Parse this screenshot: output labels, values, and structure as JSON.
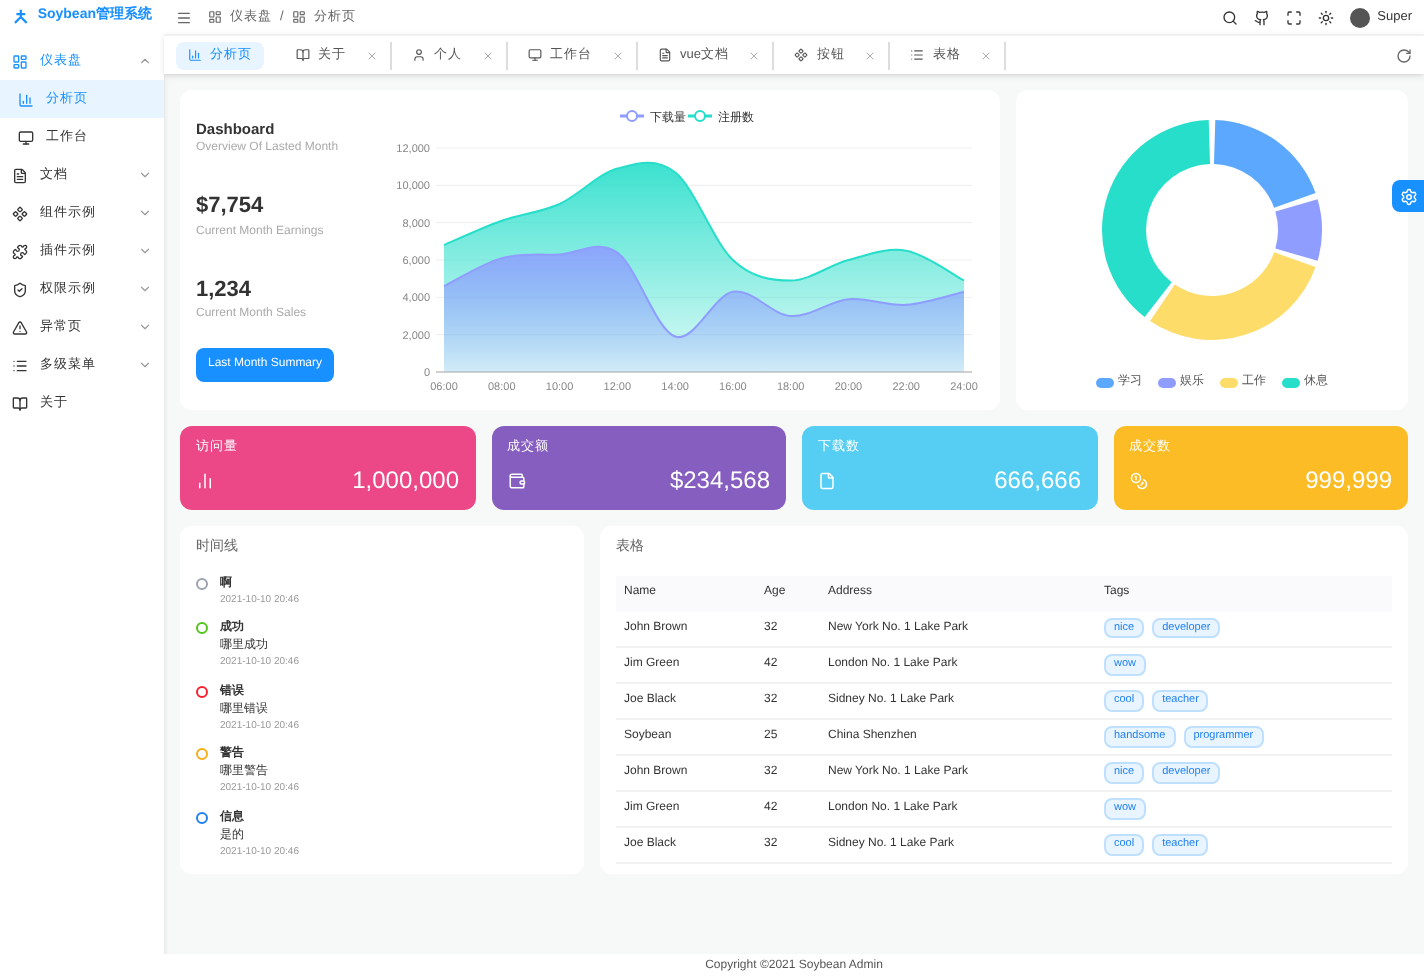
{
  "sidebar": {
    "logo": "Soybean管理系统",
    "items": [
      {
        "label": "仪表盘",
        "expanded": true,
        "children": [
          {
            "label": "分析页",
            "selected": true
          },
          {
            "label": "工作台",
            "selected": false
          }
        ]
      },
      {
        "label": "文档",
        "expanded": false
      },
      {
        "label": "组件示例",
        "expanded": false
      },
      {
        "label": "插件示例",
        "expanded": false
      },
      {
        "label": "权限示例",
        "expanded": false
      },
      {
        "label": "异常页",
        "expanded": false
      },
      {
        "label": "多级菜单",
        "expanded": false
      },
      {
        "label": "关于"
      }
    ]
  },
  "header": {
    "breadcrumb": [
      "仪表盘",
      "分析页"
    ],
    "breadcrumb_separator": "/",
    "user": "Super"
  },
  "tabs": [
    {
      "label": "分析页",
      "selected": true,
      "closable": false
    },
    {
      "label": "关于",
      "selected": false,
      "closable": true
    },
    {
      "label": "个人",
      "selected": false,
      "closable": true
    },
    {
      "label": "工作台",
      "selected": false,
      "closable": true
    },
    {
      "label": "vue文档",
      "selected": false,
      "closable": true
    },
    {
      "label": "按钮",
      "selected": false,
      "closable": true
    },
    {
      "label": "表格",
      "selected": false,
      "closable": true
    }
  ],
  "dashboard": {
    "title": "Dashboard",
    "subtitle": "Overview Of Lasted Month",
    "earnings": "$7,754",
    "earnings_label": "Current Month Earnings",
    "sales": "1,234",
    "sales_label": "Current Month Sales",
    "button": "Last Month Summary",
    "chart_data": {
      "type": "area",
      "categories": [
        "06:00",
        "08:00",
        "10:00",
        "12:00",
        "14:00",
        "16:00",
        "18:00",
        "20:00",
        "22:00",
        "24:00"
      ],
      "series": [
        {
          "name": "下载量",
          "color": "#8e9dff",
          "values": [
            4600,
            6100,
            6300,
            6400,
            1900,
            4300,
            3000,
            3900,
            3600,
            4300
          ]
        },
        {
          "name": "注册数",
          "color": "#26deca",
          "values": [
            6800,
            8100,
            9000,
            10900,
            10700,
            6000,
            4900,
            6000,
            6500,
            4900
          ]
        }
      ],
      "ylim": [
        0,
        12000
      ],
      "grid": true,
      "legend": true,
      "yticks": [
        {
          "value": 0,
          "label": "0"
        },
        {
          "value": 2000,
          "label": "2,000"
        },
        {
          "value": 4000,
          "label": "4,000"
        },
        {
          "value": 6000,
          "label": "6,000"
        },
        {
          "value": 8000,
          "label": "8,000"
        },
        {
          "value": 10000,
          "label": "10,000"
        },
        {
          "value": 12000,
          "label": "12,000"
        }
      ]
    }
  },
  "donut_legend": [
    {
      "label": "学习",
      "color": "#5da8ff"
    },
    {
      "label": "娱乐",
      "color": "#8e9dff"
    },
    {
      "label": "工作",
      "color": "#fedc69"
    },
    {
      "label": "休息",
      "color": "#26deca"
    }
  ],
  "stats": [
    {
      "title": "访问量",
      "value": "1,000,000",
      "color": "#ec4786"
    },
    {
      "title": "成交额",
      "value": "$234,568",
      "color": "#865ec0"
    },
    {
      "title": "下载数",
      "value": "666,666",
      "color": "#56cdf3"
    },
    {
      "title": "成交数",
      "value": "999,999",
      "color": "#fcbc25"
    }
  ],
  "timeline": {
    "title": "时间线",
    "items": [
      {
        "title": "啊",
        "time": "2021-10-10 20:46",
        "color": "#9ca3af"
      },
      {
        "title": "成功",
        "content": "哪里成功",
        "time": "2021-10-10 20:46",
        "color": "#52c41a"
      },
      {
        "title": "错误",
        "content": "哪里错误",
        "time": "2021-10-10 20:46",
        "color": "#f5222d"
      },
      {
        "title": "警告",
        "content": "哪里警告",
        "time": "2021-10-10 20:46",
        "color": "#faad14"
      },
      {
        "title": "信息",
        "content": "是的",
        "time": "2021-10-10 20:46",
        "color": "#2080f0"
      }
    ]
  },
  "table": {
    "title": "表格",
    "columns": [
      "Name",
      "Age",
      "Address",
      "Tags"
    ],
    "rows": [
      {
        "name": "John Brown",
        "age": "32",
        "address": "New York No. 1 Lake Park",
        "tags": [
          "nice",
          "developer"
        ]
      },
      {
        "name": "Jim Green",
        "age": "42",
        "address": "London No. 1 Lake Park",
        "tags": [
          "wow"
        ]
      },
      {
        "name": "Joe Black",
        "age": "32",
        "address": "Sidney No. 1 Lake Park",
        "tags": [
          "cool",
          "teacher"
        ]
      },
      {
        "name": "Soybean",
        "age": "25",
        "address": "China Shenzhen",
        "tags": [
          "handsome",
          "programmer"
        ]
      },
      {
        "name": "John Brown",
        "age": "32",
        "address": "New York No. 1 Lake Park",
        "tags": [
          "nice",
          "developer"
        ]
      },
      {
        "name": "Jim Green",
        "age": "42",
        "address": "London No. 1 Lake Park",
        "tags": [
          "wow"
        ]
      },
      {
        "name": "Joe Black",
        "age": "32",
        "address": "Sidney No. 1 Lake Park",
        "tags": [
          "cool",
          "teacher"
        ]
      }
    ]
  },
  "footer": "Copyright ©2021 Soybean Admin"
}
